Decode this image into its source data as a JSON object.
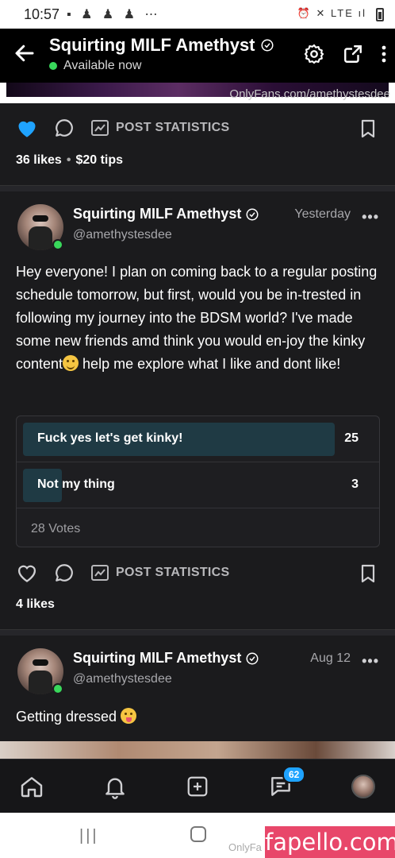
{
  "status_bar": {
    "time": "10:57",
    "icons": "▪ ♟ ♟ ♟ ⋯",
    "system": "⏰ ✕ LTE ıl"
  },
  "header": {
    "title": "Squirting MILF Amethyst",
    "status": "Available now"
  },
  "top_media": {
    "watermark": "OnlyFans.com/amethystesdee"
  },
  "post1": {
    "post_statistics_label": "POST STATISTICS",
    "likes": "36 likes",
    "tips": "$20 tips"
  },
  "post2": {
    "author": "Squirting MILF Amethyst",
    "handle": "@amethystesdee",
    "time": "Yesterday",
    "more": "•••",
    "text_before_emoji": "Hey everyone! I plan on coming back to a regular posting schedule tomorrow, but first, would you be in-trested in following my journey into the BDSM world? I've made some new friends amd think you would en-joy the kinky content",
    "text_after_emoji": " help me explore what I like and dont like!",
    "poll": {
      "options": [
        {
          "label": "Fuck yes let's get kinky!",
          "count": "25",
          "fraction": 0.89
        },
        {
          "label": "Not my thing",
          "count": "3",
          "fraction": 0.11
        }
      ],
      "votes": "28 Votes"
    },
    "post_statistics_label": "POST STATISTICS",
    "likes": "4 likes"
  },
  "post3": {
    "author": "Squirting MILF Amethyst",
    "handle": "@amethystesdee",
    "time": "Aug 12",
    "more": "•••",
    "text": "Getting dressed"
  },
  "bottom_nav": {
    "messages_badge": "62"
  },
  "system_nav": {
    "watermark": "OnlyFa",
    "site_watermark": "fapello.com"
  },
  "colors": {
    "accent": "#1fa3ff",
    "online": "#39d85b",
    "liked": "#1fa3ff",
    "poll_fill": "#1f3a44"
  }
}
